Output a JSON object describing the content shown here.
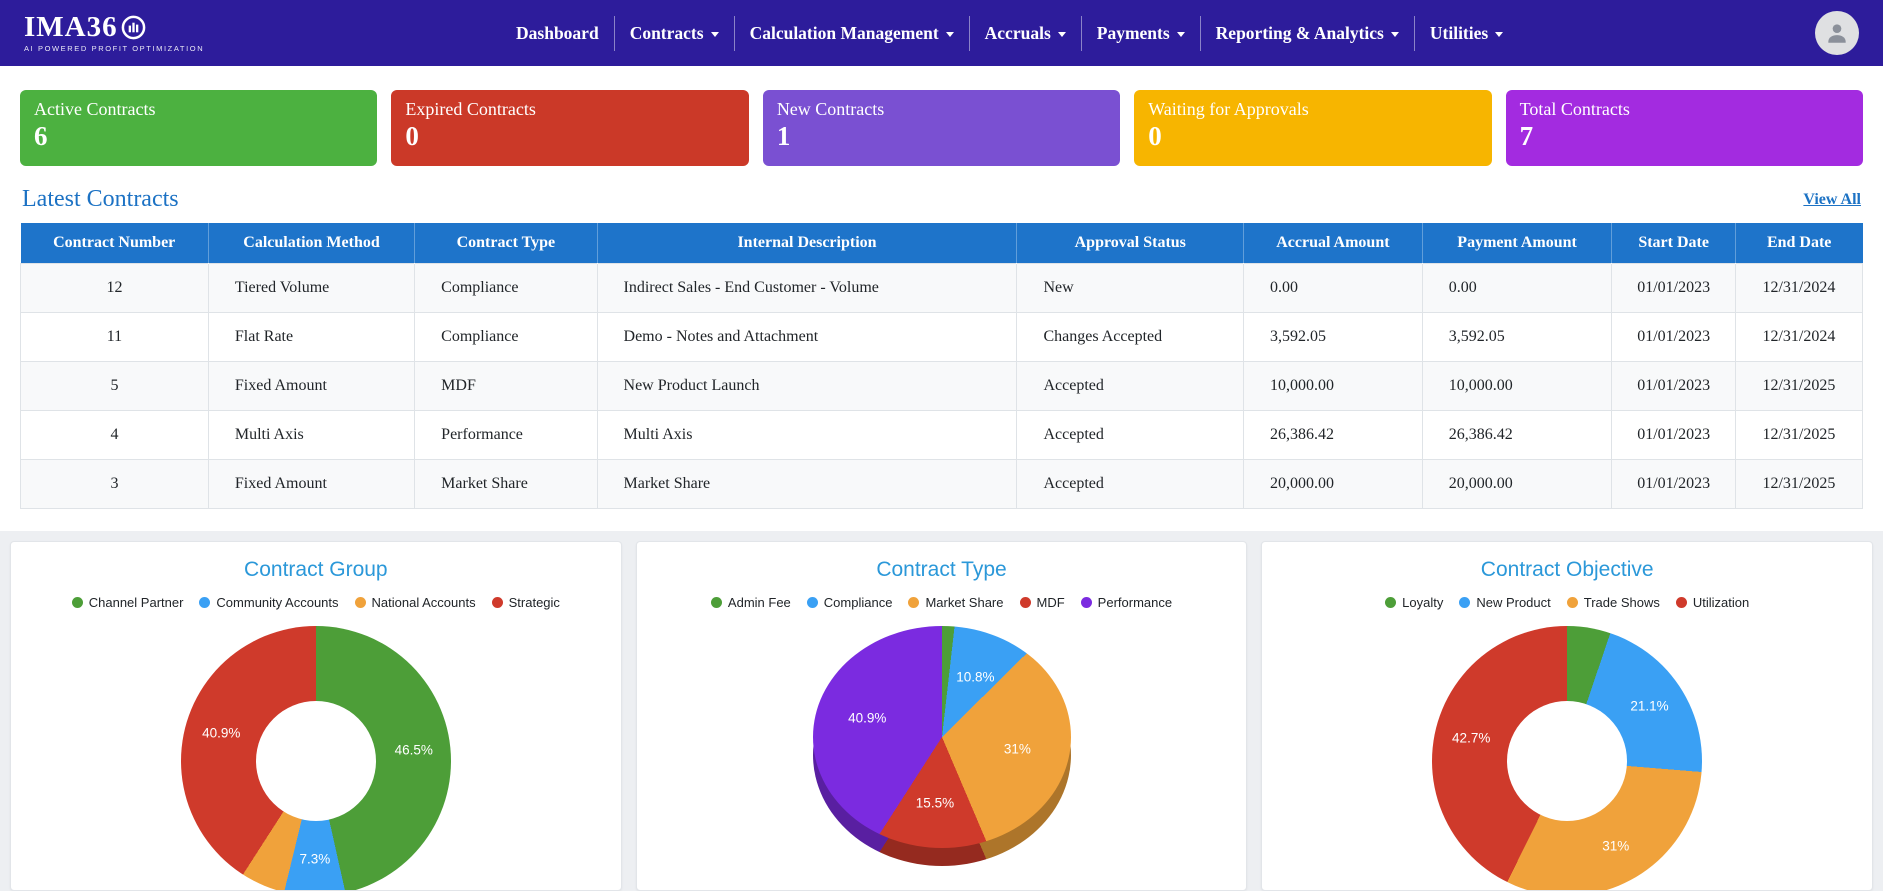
{
  "brand": {
    "logo_text": "IMA36",
    "tagline": "AI POWERED PROFIT OPTIMIZATION"
  },
  "nav": {
    "items": [
      {
        "label": "Dashboard",
        "has_dropdown": false
      },
      {
        "label": "Contracts",
        "has_dropdown": true
      },
      {
        "label": "Calculation Management",
        "has_dropdown": true
      },
      {
        "label": "Accruals",
        "has_dropdown": true
      },
      {
        "label": "Payments",
        "has_dropdown": true
      },
      {
        "label": "Reporting & Analytics",
        "has_dropdown": true
      },
      {
        "label": "Utilities",
        "has_dropdown": true
      }
    ]
  },
  "stats": {
    "cards": [
      {
        "label": "Active Contracts",
        "value": "6",
        "color": "#4cb140"
      },
      {
        "label": "Expired Contracts",
        "value": "0",
        "color": "#cb3928"
      },
      {
        "label": "New Contracts",
        "value": "1",
        "color": "#7a50d2"
      },
      {
        "label": "Waiting for Approvals",
        "value": "0",
        "color": "#f7b500"
      },
      {
        "label": "Total Contracts",
        "value": "7",
        "color": "#a32be0"
      }
    ]
  },
  "latest_contracts": {
    "heading": "Latest Contracts",
    "view_all_label": "View All",
    "columns": [
      "Contract Number",
      "Calculation Method",
      "Contract Type",
      "Internal Description",
      "Approval Status",
      "Accrual Amount",
      "Payment Amount",
      "Start Date",
      "End Date"
    ],
    "rows": [
      [
        "12",
        "Tiered Volume",
        "Compliance",
        "Indirect Sales - End Customer - Volume",
        "New",
        "0.00",
        "0.00",
        "01/01/2023",
        "12/31/2024"
      ],
      [
        "11",
        "Flat Rate",
        "Compliance",
        "Demo - Notes and Attachment",
        "Changes Accepted",
        "3,592.05",
        "3,592.05",
        "01/01/2023",
        "12/31/2024"
      ],
      [
        "5",
        "Fixed Amount",
        "MDF",
        "New Product Launch",
        "Accepted",
        "10,000.00",
        "10,000.00",
        "01/01/2023",
        "12/31/2025"
      ],
      [
        "4",
        "Multi Axis",
        "Performance",
        "Multi Axis",
        "Accepted",
        "26,386.42",
        "26,386.42",
        "01/01/2023",
        "12/31/2025"
      ],
      [
        "3",
        "Fixed Amount",
        "Market Share",
        "Market Share",
        "Accepted",
        "20,000.00",
        "20,000.00",
        "01/01/2023",
        "12/31/2025"
      ]
    ]
  },
  "chart_data": [
    {
      "type": "pie",
      "subtype": "donut",
      "title": "Contract Group",
      "legend_position": "top",
      "labels": [
        "Channel Partner",
        "Community Accounts",
        "National Accounts",
        "Strategic"
      ],
      "values": [
        46.5,
        7.3,
        5.3,
        40.9
      ],
      "colors": [
        "#4d9e38",
        "#3aa0f4",
        "#f0a23b",
        "#cf3a2b"
      ],
      "slice_labels": [
        "46.5%",
        "7.3%",
        "",
        "40.9%"
      ]
    },
    {
      "type": "pie",
      "subtype": "pie3d",
      "title": "Contract Type",
      "legend_position": "top",
      "labels": [
        "Admin Fee",
        "Compliance",
        "Market Share",
        "MDF",
        "Performance"
      ],
      "values": [
        1.8,
        10.8,
        31,
        15.5,
        40.9
      ],
      "colors": [
        "#4d9e38",
        "#3aa0f4",
        "#f0a23b",
        "#cf3a2b",
        "#7b2be0"
      ],
      "slice_labels": [
        "",
        "10.8%",
        "31%",
        "15.5%",
        "40.9%"
      ]
    },
    {
      "type": "pie",
      "subtype": "donut",
      "title": "Contract Objective",
      "legend_position": "top",
      "labels": [
        "Loyalty",
        "New Product",
        "Trade Shows",
        "Utilization"
      ],
      "values": [
        5.2,
        21.1,
        31,
        42.7
      ],
      "colors": [
        "#4d9e38",
        "#3aa0f4",
        "#f0a23b",
        "#cf3a2b"
      ],
      "slice_labels": [
        "",
        "21.1%",
        "31%",
        "42.7%"
      ]
    }
  ]
}
